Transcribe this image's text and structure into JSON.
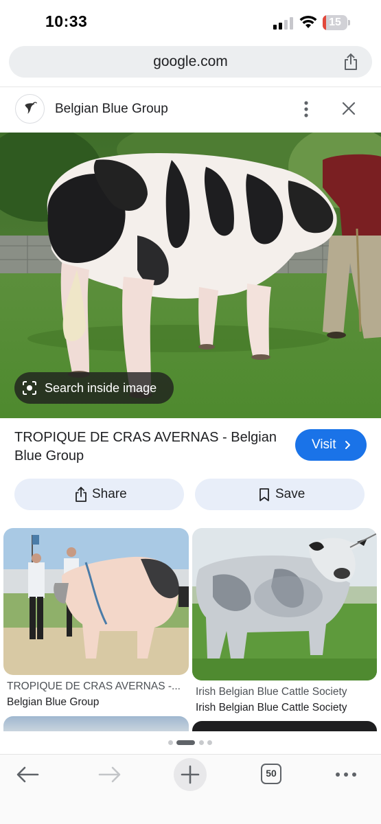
{
  "status_bar": {
    "time": "10:33",
    "battery_level": "15",
    "battery_fraction": 0.15,
    "battery_color": "#e2483b"
  },
  "address_bar": {
    "url": "google.com",
    "share_icon": "share-icon"
  },
  "source": {
    "name": "Belgian Blue Group",
    "favicon": "bull-logo-icon",
    "menu_icon": "vertical-dots-icon",
    "close_icon": "close-icon"
  },
  "hero": {
    "search_inside_label": "Search inside image",
    "search_inside_icon": "lens-icon"
  },
  "result": {
    "title": "TROPIQUE DE CRAS AVERNAS - Belgian Blue Group",
    "visit_label": "Visit",
    "visit_icon": "chevron-right-icon"
  },
  "actions": {
    "share_label": "Share",
    "share_icon": "share-icon",
    "save_label": "Save",
    "save_icon": "bookmark-icon"
  },
  "related": [
    {
      "title": "TROPIQUE DE CRAS AVERNAS -...",
      "source": "Belgian Blue Group"
    },
    {
      "title": "Irish Belgian Blue Cattle Society",
      "source": "Irish Belgian Blue Cattle Society"
    }
  ],
  "toolbar": {
    "back_icon": "arrow-left-icon",
    "forward_icon": "arrow-right-icon",
    "new_tab_icon": "plus-icon",
    "tab_count": "50",
    "more_icon": "horizontal-dots-icon"
  },
  "colors": {
    "accent": "#1a73e8",
    "pill_bg": "#e8eef9"
  }
}
